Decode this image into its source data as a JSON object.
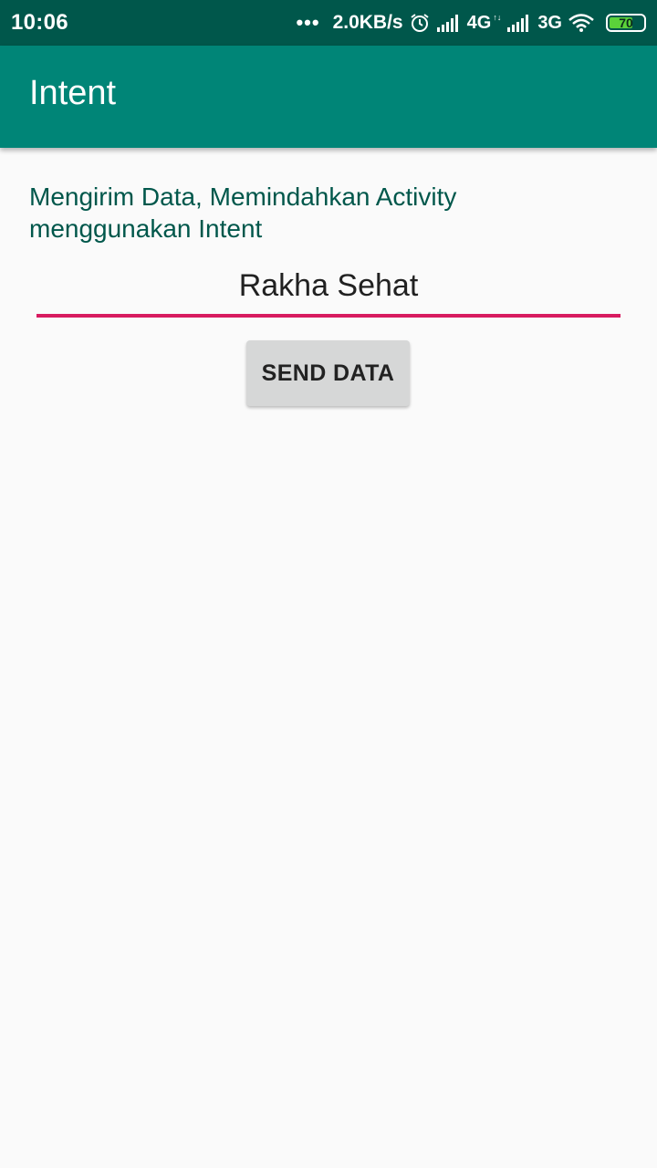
{
  "status_bar": {
    "time": "10:06",
    "dots": "•••",
    "speed": "2.0KB/s",
    "network_1": "4G",
    "network_1_sub": "↑↓",
    "network_2": "3G",
    "battery": "70",
    "battery_level": 0.7,
    "icons": [
      "alarm-icon",
      "signal-icon",
      "signal-icon",
      "wifi-icon",
      "battery-icon"
    ]
  },
  "app_bar": {
    "title": "Intent"
  },
  "main": {
    "description": "Mengirim Data, Memindahkan Activity menggunakan Intent",
    "input_value": "Rakha Sehat",
    "send_button_label": "SEND DATA"
  },
  "colors": {
    "status_bar": "#00574b",
    "app_bar": "#008577",
    "accent": "#d81b60",
    "text_primary_dark": "#00574b",
    "button_bg": "#d6d7d7",
    "background": "#fafafa"
  }
}
